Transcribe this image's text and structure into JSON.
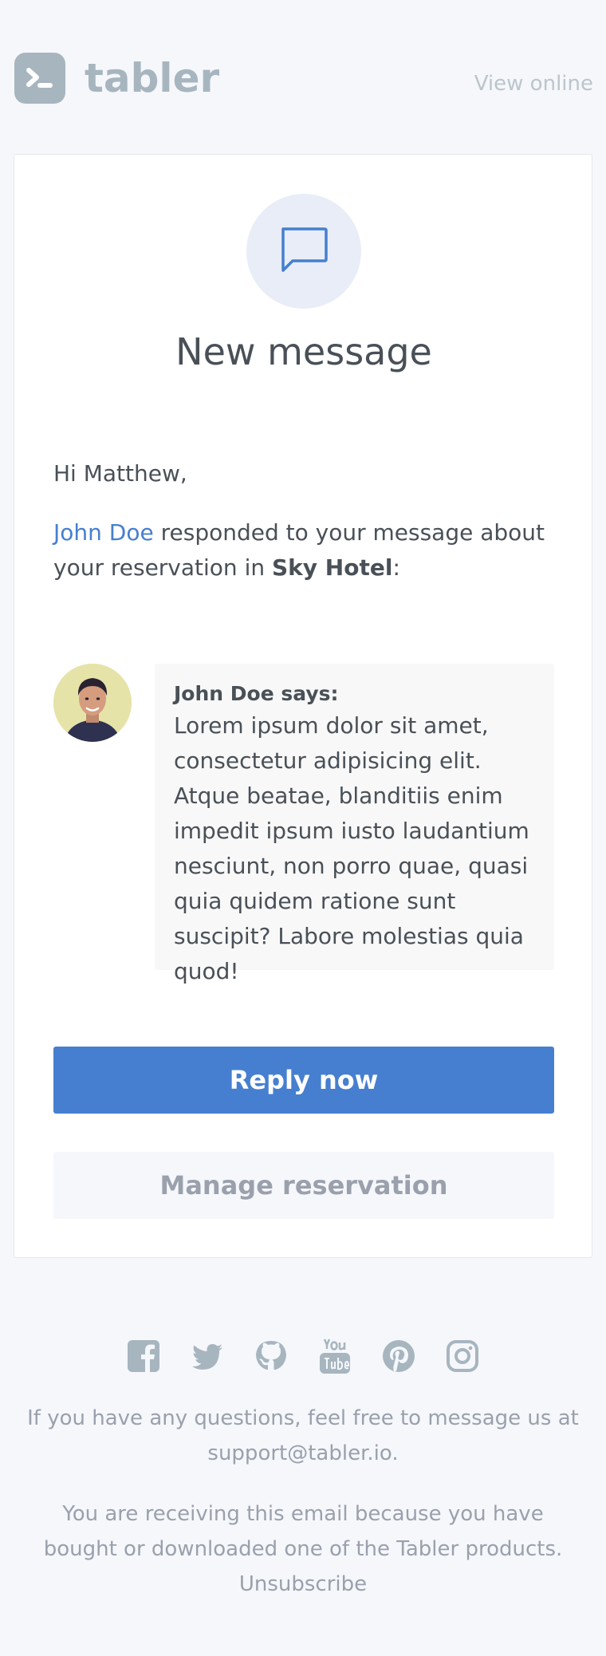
{
  "header": {
    "brand": "tabler",
    "view_online": "View online"
  },
  "card": {
    "icon": "message-square-icon",
    "title": "New message",
    "greeting": "Hi Matthew,",
    "intro": {
      "sender": "John Doe",
      "text_before_hotel": " responded to your message about your reservation in ",
      "hotel": "Sky Hotel",
      "text_after_hotel": ":"
    },
    "quote": {
      "author": "John Doe says:",
      "text": "Lorem ipsum dolor sit amet, consectetur adipisicing elit. Atque beatae, blanditiis enim impedit ipsum iusto laudantium nesciunt, non porro quae, quasi quia quidem ratione sunt suscipit? Labore molestias quia quod!"
    },
    "primary_button": "Reply now",
    "secondary_button": "Manage reservation"
  },
  "footer": {
    "socials": [
      "facebook-icon",
      "twitter-icon",
      "github-icon",
      "youtube-icon",
      "pinterest-icon",
      "instagram-icon"
    ],
    "questions_text": "If you have any questions, feel free to message us at",
    "support_email": "support@tabler.io",
    "support_email_suffix": ".",
    "receiving_text": "You are receiving this email because you have bought or downloaded one of the Tabler products.",
    "unsubscribe": "Unsubscribe"
  },
  "colors": {
    "background": "#f5f7fb",
    "primary": "#467fcf",
    "muted": "#9aa0ac",
    "brand_gray": "#a7b5bf"
  }
}
